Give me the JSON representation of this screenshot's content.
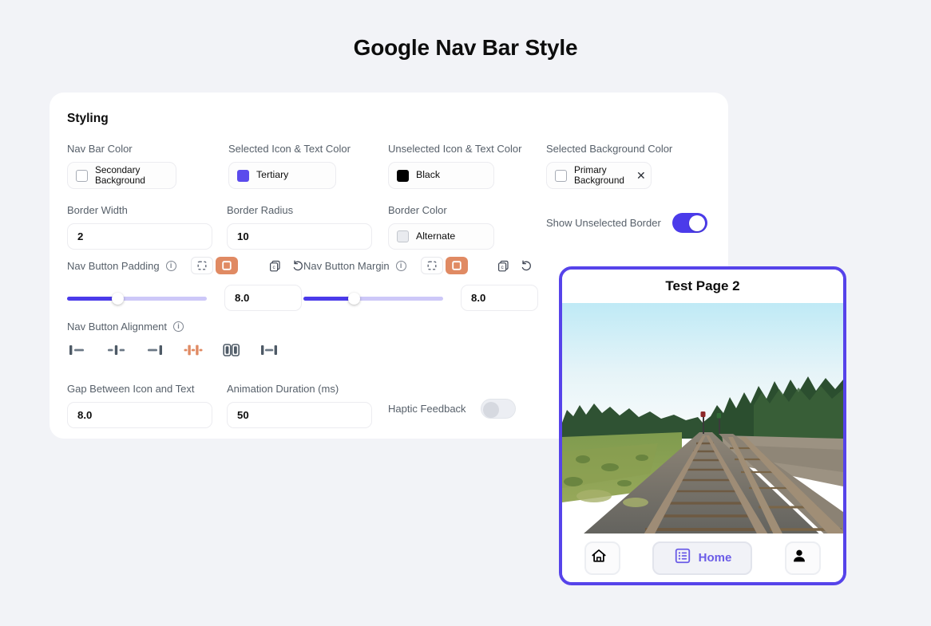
{
  "header": {
    "title": "Google Nav Bar Style"
  },
  "settings": {
    "heading": "Styling",
    "colors": [
      {
        "label": "Nav Bar Color",
        "value": "Secondary Background",
        "swatch": "outline-white",
        "clearable": false
      },
      {
        "label": "Selected Icon & Text Color",
        "value": "Tertiary",
        "swatch": "#5b4bec",
        "clearable": false
      },
      {
        "label": "Unselected Icon & Text Color",
        "value": "Black",
        "swatch": "#000000",
        "clearable": false
      },
      {
        "label": "Selected Background Color",
        "value": "Primary Background",
        "swatch": "outline-white",
        "clearable": true,
        "clear_icon": "close-icon"
      }
    ],
    "border_width": {
      "label": "Border Width",
      "value": "2"
    },
    "border_radius": {
      "label": "Border Radius",
      "value": "10"
    },
    "border_color": {
      "label": "Border Color",
      "value": "Alternate",
      "swatch": "outline-grey"
    },
    "show_unselected_border": {
      "label": "Show Unselected Border",
      "state": "on"
    },
    "nav_button_padding": {
      "label": "Nav Button Padding",
      "info_icon": "info-icon",
      "modes": [
        {
          "name": "horizontal-padding-icon",
          "selected": false
        },
        {
          "name": "all-padding-icon",
          "selected": true
        }
      ],
      "copy_icon": "copy-icon",
      "reset_icon": "reset-icon",
      "slider_percent": 36,
      "value": "8.0"
    },
    "nav_button_margin": {
      "label": "Nav Button Margin",
      "info_icon": "info-icon",
      "modes": [
        {
          "name": "horizontal-margin-icon",
          "selected": false
        },
        {
          "name": "all-margin-icon",
          "selected": true
        }
      ],
      "copy_icon": "copy-icon",
      "reset_icon": "reset-icon",
      "slider_percent": 36,
      "value": "8.0"
    },
    "nav_button_alignment": {
      "label": "Nav Button Alignment",
      "info_icon": "info-icon",
      "options": [
        {
          "name": "align-start-icon",
          "selected": false
        },
        {
          "name": "align-center-icon",
          "selected": false
        },
        {
          "name": "align-end-icon",
          "selected": false
        },
        {
          "name": "space-around-icon",
          "selected": true
        },
        {
          "name": "space-evenly-icon",
          "selected": false
        },
        {
          "name": "space-between-icon",
          "selected": false
        }
      ]
    },
    "gap_icon_text": {
      "label": "Gap Between Icon and Text",
      "value": "8.0"
    },
    "animation_duration": {
      "label": "Animation Duration (ms)",
      "value": "50"
    },
    "haptic_feedback": {
      "label": "Haptic Feedback",
      "state": "off"
    }
  },
  "preview": {
    "title": "Test Page 2",
    "photo_alt": "railway-track-photo",
    "navbar": {
      "items": [
        {
          "icon": "home-icon",
          "label": "",
          "selected": false
        },
        {
          "icon": "list-icon",
          "label": "Home",
          "selected": true
        },
        {
          "icon": "person-icon",
          "label": "",
          "selected": false
        }
      ]
    }
  },
  "theme": {
    "page_background": "#f2f3f7",
    "card_background": "#ffffff",
    "accent_purple": "#4b3bea",
    "accent_orange": "#e08a63",
    "selected_text": "#6b5ce7",
    "label_grey": "#57606a",
    "align_icon_grey": "#4e5a66"
  }
}
